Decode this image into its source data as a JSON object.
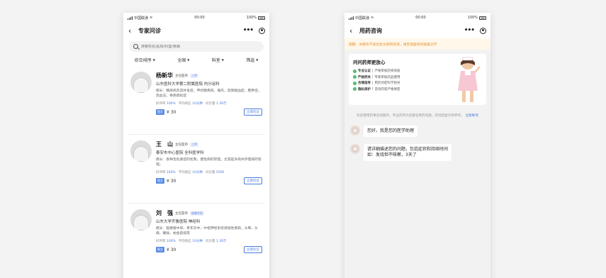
{
  "phone1": {
    "status": {
      "carrier": "中国联通",
      "time": "00:00",
      "battery": "100%"
    },
    "nav": {
      "title": "专家问诊"
    },
    "search": {
      "placeholder": "搜索姓名/医院/科室/疾病"
    },
    "filters": [
      {
        "label": "综合排序"
      },
      {
        "label": "全国"
      },
      {
        "label": "科室"
      },
      {
        "label": "筛选"
      }
    ],
    "doctors": [
      {
        "name": "杨新华",
        "title": "主任医师",
        "tag": "三甲",
        "hospital": "山东医科大学第二附属医院   内分泌科",
        "desc": "擅长：糖尿病及其并发症，甲状腺疾病，痛风，高尿酸血症，肥胖症，高血压，骨质疏松症",
        "satisfaction_label": "好评率",
        "satisfaction": "100%",
        "response_label": "平均响应",
        "response": "10分钟",
        "consults_label": "问诊量",
        "consults": "1.39万",
        "consult_type": "图文",
        "price": "¥ 30",
        "button": "立即问诊"
      },
      {
        "name": "王　山",
        "title": "主任医师",
        "tag": "三甲",
        "hospital": "泰安市中心医院   全科医学科",
        "desc": "擅长：各种急危重症的抢救，慢性病的管理，尤其是多病共存慢病的管理。",
        "satisfaction_label": "好评率",
        "satisfaction": "100%",
        "response_label": "平均响应",
        "response": "10分钟",
        "consults_label": "问诊量",
        "consults": "5000",
        "consult_type": "图文",
        "price": "¥ 30",
        "button": "立即问诊"
      },
      {
        "name": "刘　强",
        "title": "主任医师",
        "tag": "权威专家",
        "hospital": "山东大学齐鲁医院   神经科",
        "desc": "擅长：脑梗塞中早，青年卒中，中枢神经系统感染性疾病，头晕，头痛，癫痫，帕金森病等",
        "satisfaction_label": "好评率",
        "satisfaction": "100%",
        "response_label": "平均响应",
        "response": "10分钟",
        "consults_label": "问诊量",
        "consults": "1.39万",
        "consult_type": "图文",
        "price": "¥ 30",
        "button": "立即问诊"
      }
    ]
  },
  "phone2": {
    "status": {
      "carrier": "中国联通",
      "time": "00:00",
      "battery": "100%"
    },
    "nav": {
      "title": "用药咨询"
    },
    "notice": "提醒：本服务不适合急诊病例咨询，请至就医机构就医诊疗",
    "promo": {
      "title": "问问药师更放心",
      "items": [
        {
          "title": "专业认证",
          "text": "严格审核药师资质"
        },
        {
          "title": "严格把关",
          "text": "专家审核药品使用"
        },
        {
          "title": "合理指导",
          "text": "用药对症科学指导"
        },
        {
          "title": "隐私保护",
          "text": "咨询内容严格保密"
        }
      ]
    },
    "hint": {
      "text": "欢迎使用药事咨询服务，专业药师为您解答用药问题，药师回复仅供参考。",
      "link": "注意事项"
    },
    "messages": [
      {
        "text": "您好，我是您的医学助理"
      },
      {
        "line1": "请详细描述您的问题，包括症状和持续时间",
        "line2": "如：发烧但不咳嗽，3天了"
      }
    ]
  }
}
